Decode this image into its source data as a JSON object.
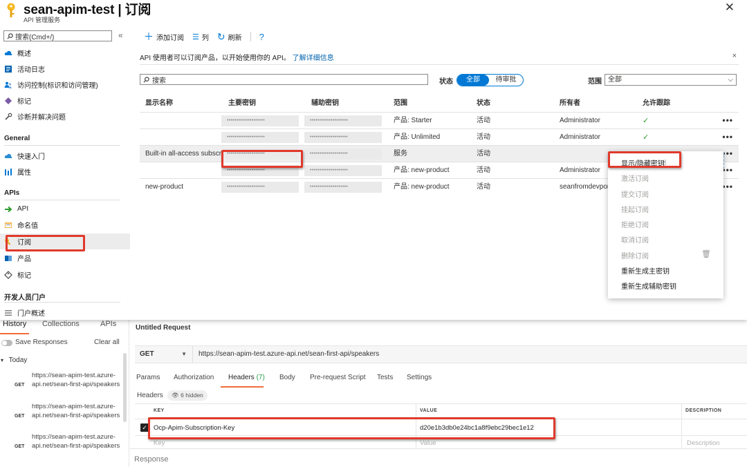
{
  "portal": {
    "title": "sean-apim-test | 订阅",
    "subtitle": "API 管理服务",
    "close": "✕",
    "search_placeholder": "搜索(Cmd+/)",
    "collapse": "«",
    "nav": [
      {
        "label": "概述",
        "icon": "cloud-icon"
      },
      {
        "label": "活动日志",
        "icon": "log-icon"
      },
      {
        "label": "访问控制(标识和访问管理)",
        "icon": "people-icon"
      },
      {
        "label": "标记",
        "icon": "tag-icon"
      },
      {
        "label": "诊断并解决问题",
        "icon": "wrench-icon"
      }
    ],
    "group_general": "General",
    "nav_general": [
      {
        "label": "快速入门",
        "icon": "cloud-icon"
      },
      {
        "label": "属性",
        "icon": "bars-icon"
      }
    ],
    "group_apis": "APIs",
    "nav_apis": [
      {
        "label": "API",
        "icon": "arrow-icon"
      },
      {
        "label": "命名值",
        "icon": "grid-icon"
      },
      {
        "label": "订阅",
        "icon": "key-icon"
      },
      {
        "label": "产品",
        "icon": "product-icon"
      },
      {
        "label": "标记",
        "icon": "tag-icon"
      }
    ],
    "group_dev": "开发人员门户",
    "nav_dev": [
      {
        "label": "门户概述",
        "icon": "list-icon"
      }
    ],
    "toolbar": {
      "add": "添加订阅",
      "columns": "列",
      "refresh": "刷新",
      "help": "?"
    },
    "info_text": "API 使用者可以订阅产品，以开始使用你的 API。",
    "info_link": "了解详细信息",
    "info_close": "×",
    "filter": {
      "search_placeholder": "搜索",
      "status_label": "状态",
      "status_all": "全部",
      "status_pending": "待审批",
      "scope_label": "范围",
      "scope_value": "全部"
    },
    "columns": [
      "显示名称",
      "主要密钥",
      "辅助密钥",
      "范围",
      "状态",
      "所有者",
      "允许跟踪"
    ],
    "masked_key": "••••••••••••••••••••",
    "more": "•••",
    "check": "✓",
    "rows": [
      {
        "name": "",
        "scope": "产品: Starter",
        "status": "活动",
        "owner": "Administrator",
        "trace": true
      },
      {
        "name": "",
        "scope": "产品: Unlimited",
        "status": "活动",
        "owner": "Administrator",
        "trace": true
      },
      {
        "name": "Built-in all-access subscr...",
        "scope": "服务",
        "status": "活动",
        "owner": "",
        "trace": false
      },
      {
        "name": "",
        "scope": "产品: new-product",
        "status": "活动",
        "owner": "Administrator",
        "trace": false
      },
      {
        "name": "new-product",
        "scope": "产品: new-product",
        "status": "活动",
        "owner": "seanfromdevpor",
        "trace": false
      }
    ],
    "context_menu": [
      {
        "label": "显示/隐藏密钥",
        "disabled": false
      },
      {
        "label": "激活订阅",
        "disabled": true
      },
      {
        "label": "提交订阅",
        "disabled": true
      },
      {
        "label": "挂起订阅",
        "disabled": true
      },
      {
        "label": "拒绝订阅",
        "disabled": true
      },
      {
        "label": "取消订阅",
        "disabled": true
      },
      {
        "label": "删除订阅",
        "disabled": true
      },
      {
        "label": "重新生成主密钥",
        "disabled": false
      },
      {
        "label": "重新生成辅助密钥",
        "disabled": false
      }
    ],
    "trash": "🗑"
  },
  "postman": {
    "tabs": [
      "History",
      "Collections",
      "APIs"
    ],
    "save_responses": "Save Responses",
    "clear_all": "Clear all",
    "today": "Today",
    "history": [
      {
        "method": "GET",
        "url": "https://sean-apim-test.azure-api.net/sean-first-api/speakers"
      },
      {
        "method": "GET",
        "url": "https://sean-apim-test.azure-api.net/sean-first-api/speakers"
      },
      {
        "method": "GET",
        "url": "https://sean-apim-test.azure-api.net/sean-first-api/speakers"
      }
    ],
    "request_title": "Untitled Request",
    "method": "GET",
    "url": "https://sean-apim-test.azure-api.net/sean-first-api/speakers",
    "subtabs": [
      "Params",
      "Authorization",
      "Headers",
      "Body",
      "Pre-request Script",
      "Tests",
      "Settings"
    ],
    "headers_count": "(7)",
    "headers_label": "Headers",
    "hidden_label": "6 hidden",
    "table_cols": [
      "KEY",
      "VALUE",
      "DESCRIPTION"
    ],
    "header_key": "Ocp-Apim-Subscription-Key",
    "header_value": "d20e1b3db0e24bc1a8f9ebc29bec1e12",
    "key_placeholder": "Key",
    "value_placeholder": "Value",
    "desc_placeholder": "Description",
    "response": "Response"
  },
  "colors": {
    "accent": "#0078d4",
    "highlight": "#e0392b",
    "postman_accent": "#f26b3a"
  }
}
